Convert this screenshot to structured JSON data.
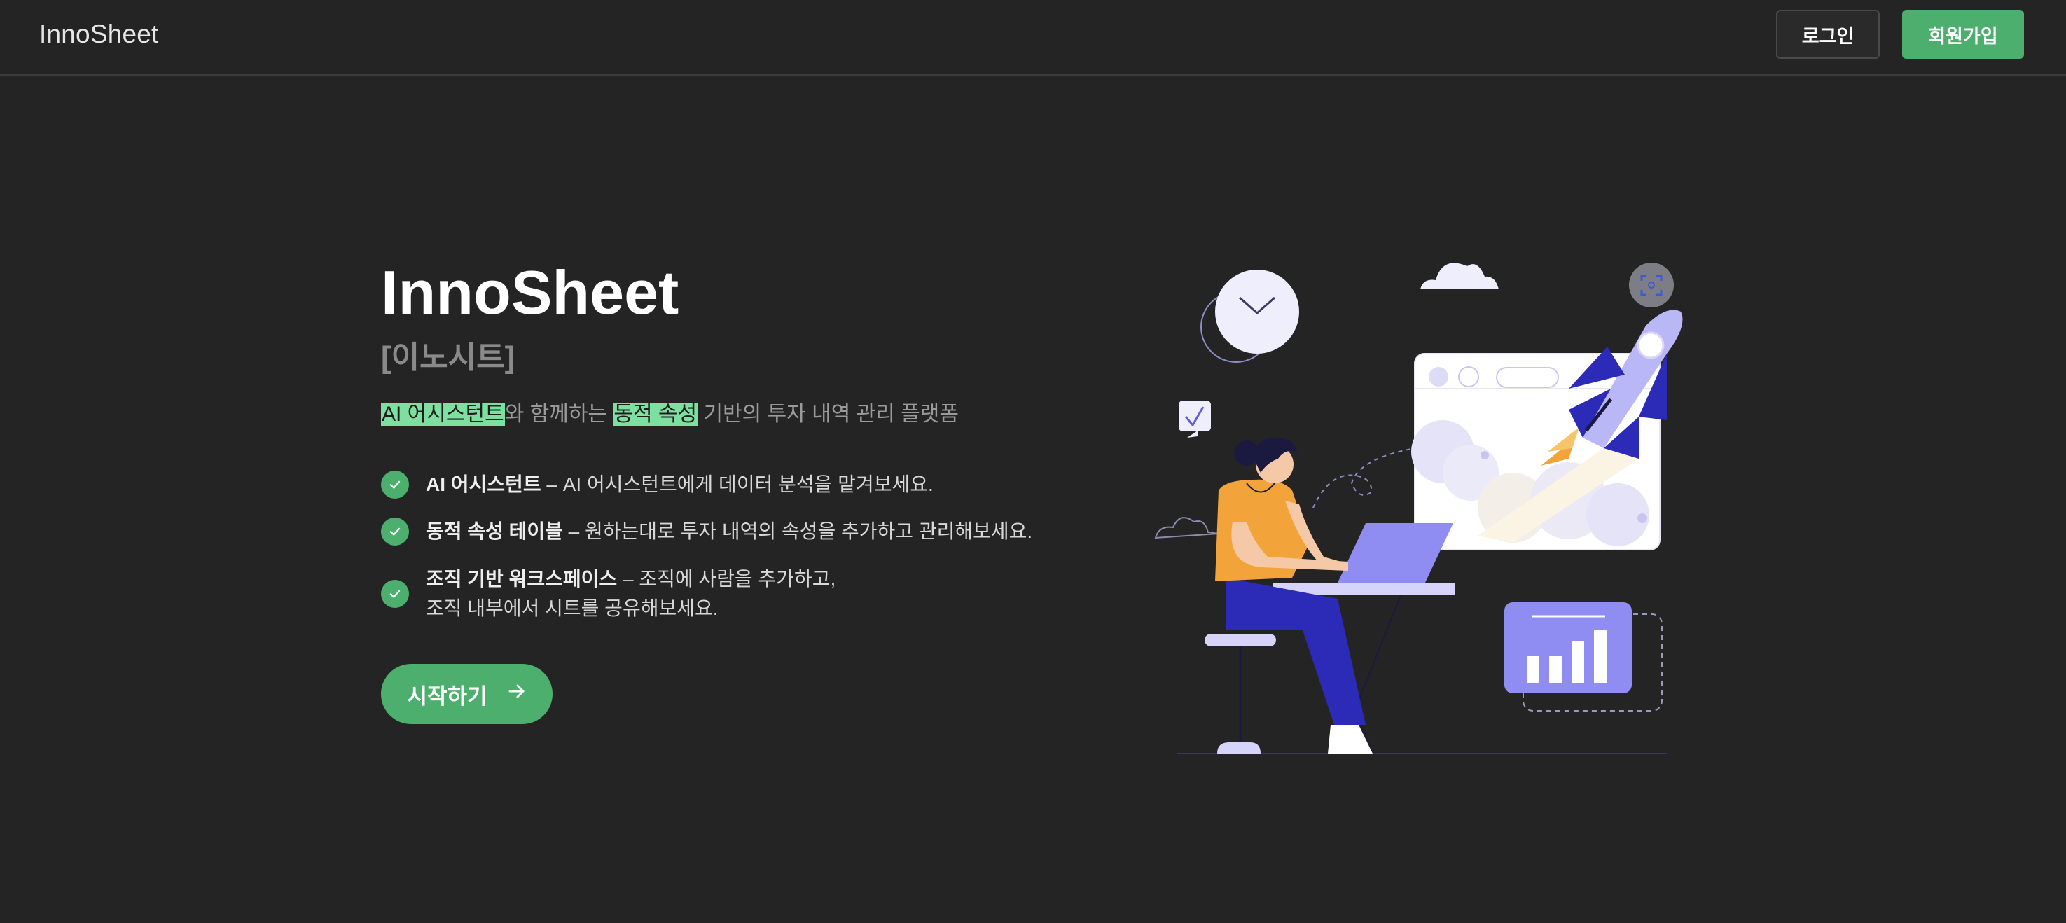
{
  "header": {
    "logo": "InnoSheet",
    "login_label": "로그인",
    "signup_label": "회원가입"
  },
  "hero": {
    "title": "InnoSheet",
    "subtitle": "[이노시트]",
    "tagline": {
      "highlight1": "AI 어시스턴트",
      "part1": "와 함께하는 ",
      "highlight2": "동적 속성",
      "part2": " 기반의 투자 내역 관리 플랫폼"
    },
    "features": [
      {
        "title": "AI 어시스턴트",
        "desc": " – AI 어시스턴트에게 데이터 분석을 맡겨보세요."
      },
      {
        "title": "동적 속성 테이블",
        "desc": " – 원하는대로 투자 내역의 속성을 추가하고 관리해보세요."
      },
      {
        "title": "조직 기반 워크스페이스",
        "desc": " – 조직에 사람을 추가하고,",
        "desc2": "조직 내부에서 시트를 공유해보세요."
      }
    ],
    "cta_label": "시작하기"
  },
  "colors": {
    "background": "#242424",
    "accent": "#4caf6e",
    "highlight": "#7ee0a0",
    "illustration_purple": "#8f8cf2",
    "illustration_navy": "#2b2bb8"
  },
  "icons": {
    "check": "check-icon",
    "cta_arrow": "arrow-right-icon"
  }
}
